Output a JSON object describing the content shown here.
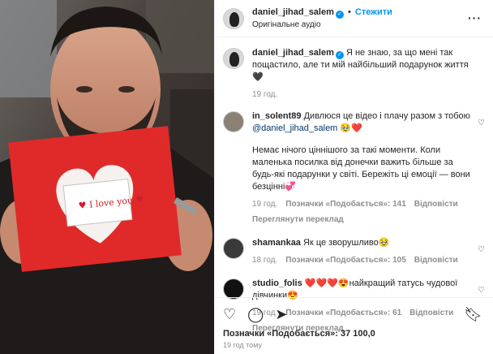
{
  "header": {
    "username": "daniel_jihad_salem",
    "follow_label": "Стежити",
    "subtitle": "Оригінальне аудіо",
    "more_label": "···"
  },
  "caption": {
    "username": "daniel_jihad_salem",
    "text": "Я не знаю, за що мені так пощастило, але ти мій найбільший подарунок життя🖤",
    "time": "19 год."
  },
  "comments": [
    {
      "username": "in_solent89",
      "text_before": "Дивлюся це відео і плачу разом з тобою",
      "mention": "@daniel_jihad_salem",
      "emoji": "🥹❤️",
      "text_after": "Немає нічого ціннішого за такі моменти. Коли маленька посилка від донечки важить більше за будь-які подарунки у світі. Бережіть ці емоції — вони безцінні💞",
      "time": "19 год.",
      "likes": "Позначки «Подобається»: 141",
      "reply": "Відповісти",
      "translate": "Переглянути переклад"
    },
    {
      "username": "shamankaa",
      "text": "Як це зворушливо🥹",
      "time": "18 год.",
      "likes": "Позначки «Подобається»: 105",
      "reply": "Відповісти"
    },
    {
      "username": "studio_folis",
      "text": "❤️❤️❤️😍найкращий татусь чудової дівчинки😍",
      "time": "19 год.",
      "likes": "Позначки «Подобається»: 61",
      "reply": "Відповісти",
      "translate": "Переглянути переклад"
    }
  ],
  "footer": {
    "likes": "Позначки «Подобається»: 37 100,0",
    "time": "19 год тому"
  },
  "icons": {
    "like": "heart-outline-icon",
    "comment": "comment-bubble-icon",
    "share": "send-paper-plane-icon",
    "save": "bookmark-icon"
  },
  "colors": {
    "accent": "#0095f6",
    "muted": "#8e8e8e",
    "text": "#262626",
    "card_red": "#e02a2a"
  }
}
